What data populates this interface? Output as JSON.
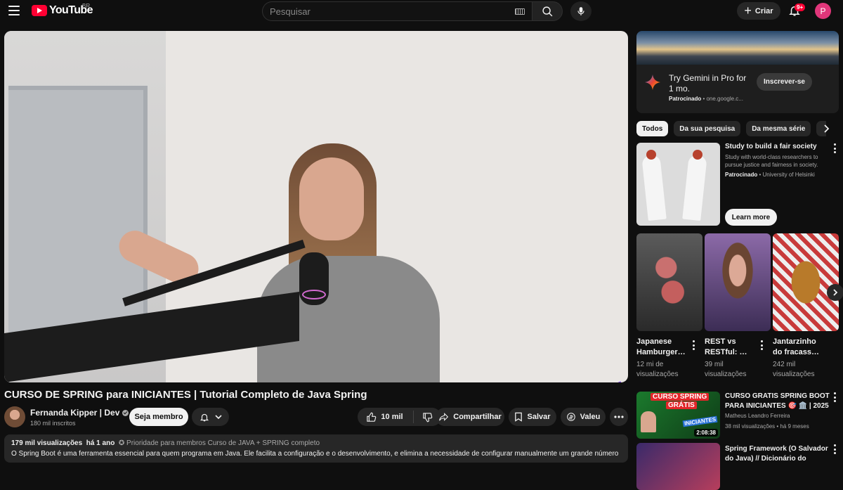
{
  "masthead": {
    "logo_text": "YouTube",
    "country": "BR",
    "search_placeholder": "Pesquisar",
    "create_label": "Criar",
    "notifications_badge": "9+",
    "avatar_initial": "P"
  },
  "video": {
    "title": "CURSO DE SPRING para INICIANTES | Tutorial Completo de Java Spring",
    "channel_name": "Fernanda Kipper | Dev",
    "channel_subs": "180 mil inscritos",
    "member_label": "Seja membro",
    "like_count": "10 mil",
    "share_label": "Compartilhar",
    "save_label": "Salvar",
    "thanks_label": "Valeu"
  },
  "description": {
    "views": "179 mil visualizações",
    "age": "há 1 ano",
    "tags": "✪ Prioridade para membros  Curso de JAVA + SPRING completo",
    "text": "O Spring Boot é uma ferramenta essencial para quem programa em Java. Ele facilita a configuração e o desenvolvimento, e elimina a necessidade de configurar manualmente um grande número"
  },
  "ad": {
    "title": "Try Gemini in Pro for 1 mo.",
    "sponsored": "Patrocinado",
    "domain": "one.google.c...",
    "subscribe_label": "Inscrever-se"
  },
  "chips": [
    "Todos",
    "Da sua pesquisa",
    "Da mesma série"
  ],
  "promo": {
    "title": "Study to build a fair society",
    "desc": "Study with world-class researchers to pursue justice and fairness in society.",
    "sponsored": "Patrocinado",
    "org": "University of Helsinki",
    "cta": "Learn more"
  },
  "shorts": [
    {
      "title": "Japanese Hamburger…",
      "views": "12 mi de visualizações"
    },
    {
      "title": "REST vs RESTful: …",
      "views": "39 mil visualizações"
    },
    {
      "title": "Jantarzinho do fracass…",
      "views": "242 mil visualizações"
    }
  ],
  "recommendations": [
    {
      "title": "CURSO GRATIS SPRING BOOT PARA INICIANTES 🎯 🏛️ | 2025",
      "channel": "Matheus Leandro Ferreira",
      "meta": "38 mil visualizações • há 9 meses",
      "duration": "2:08:38",
      "thumb_text1": "CURSO SPRING",
      "thumb_text2": "GRÁTIS",
      "thumb_text3": "INICIANTES"
    },
    {
      "title": "Spring Framework (O Salvador do Java) // Dicionário do",
      "channel": "",
      "meta": ""
    }
  ],
  "colors": {
    "background": "#0f0f0f",
    "surface": "#272727",
    "brand_red": "#ff0033",
    "text_primary": "#f1f1f1",
    "text_secondary": "#aaaaaa"
  }
}
